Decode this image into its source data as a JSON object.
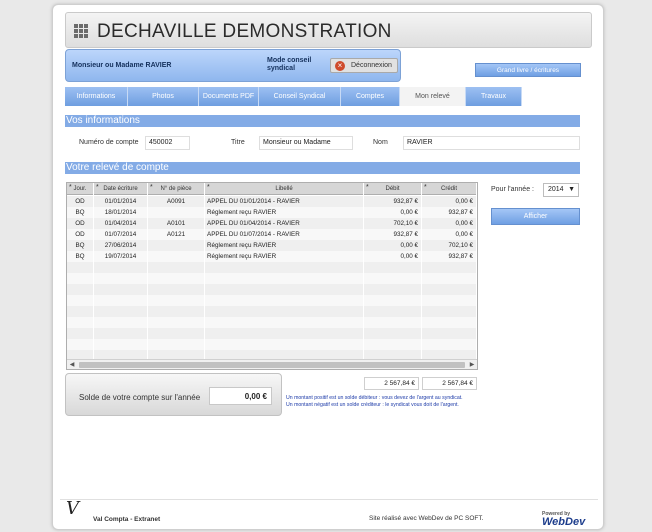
{
  "app": {
    "title": "DECHAVILLE DEMONSTRATION"
  },
  "userbar": {
    "user_name": "Monsieur ou Madame RAVIER",
    "mode": "Mode conseil syndical",
    "logout_label": "Déconnexion"
  },
  "ledger_button": "Grand livre / écritures",
  "tabs": [
    {
      "label": "Informations"
    },
    {
      "label": "Photos"
    },
    {
      "label": "Documents PDF"
    },
    {
      "label": "Conseil Syndical"
    },
    {
      "label": "Comptes"
    },
    {
      "label": "Mon relevé",
      "active": true
    },
    {
      "label": "Travaux"
    }
  ],
  "info": {
    "section_title": "Vos informations",
    "account_label": "Numéro de compte",
    "account_value": "450002",
    "title_label": "Titre",
    "title_value": "Monsieur ou Madame",
    "name_label": "Nom",
    "name_value": "RAVIER"
  },
  "statement": {
    "section_title": "Votre relevé de compte",
    "columns": [
      "Jour.",
      "Date écriture",
      "N° de pièce",
      "Libellé",
      "Débit",
      "Crédit"
    ],
    "rows": [
      {
        "jour": "OD",
        "date": "01/01/2014",
        "piece": "A0091",
        "libelle": "APPEL DU 01/01/2014 - RAVIER",
        "debit": "932,87 €",
        "credit": "0,00 €"
      },
      {
        "jour": "BQ",
        "date": "18/01/2014",
        "piece": "",
        "libelle": "Réglement reçu RAVIER",
        "debit": "0,00 €",
        "credit": "932,87 €"
      },
      {
        "jour": "OD",
        "date": "01/04/2014",
        "piece": "A0101",
        "libelle": "APPEL DU 01/04/2014 - RAVIER",
        "debit": "702,10 €",
        "credit": "0,00 €"
      },
      {
        "jour": "OD",
        "date": "01/07/2014",
        "piece": "A0121",
        "libelle": "APPEL DU 01/07/2014 - RAVIER",
        "debit": "932,87 €",
        "credit": "0,00 €"
      },
      {
        "jour": "BQ",
        "date": "27/06/2014",
        "piece": "",
        "libelle": "Réglement reçu RAVIER",
        "debit": "0,00 €",
        "credit": "702,10 €"
      },
      {
        "jour": "BQ",
        "date": "19/07/2014",
        "piece": "",
        "libelle": "Réglement reçu RAVIER",
        "debit": "0,00 €",
        "credit": "932,87 €"
      }
    ],
    "empty_rows": 9,
    "total_debit": "2 567,84 €",
    "total_credit": "2 567,84 €"
  },
  "year": {
    "label": "Pour l'année :",
    "value": "2014"
  },
  "show_button": "Afficher",
  "balance": {
    "label": "Solde de votre compte sur l'année",
    "value": "0,00 €",
    "note_positive": "Un montant positif est un solde débiteur : vous devez de l'argent au syndicat.",
    "note_negative": "Un montant négatif est un solde créditeur : le syndicat vous doit de l'argent."
  },
  "footer": {
    "logo_letter": "V",
    "app_name": "Val Compta - Extranet",
    "credit": "Site réalisé avec WebDev de PC SOFT.",
    "powered_small": "Powered by",
    "powered_big": "WebDev"
  },
  "colors": {
    "accent": "#83abe6",
    "note": "#1c3aa8",
    "logout": "#cf4b2c"
  },
  "icons": {
    "app": "grid-icon",
    "logout": "close-circle-icon"
  }
}
